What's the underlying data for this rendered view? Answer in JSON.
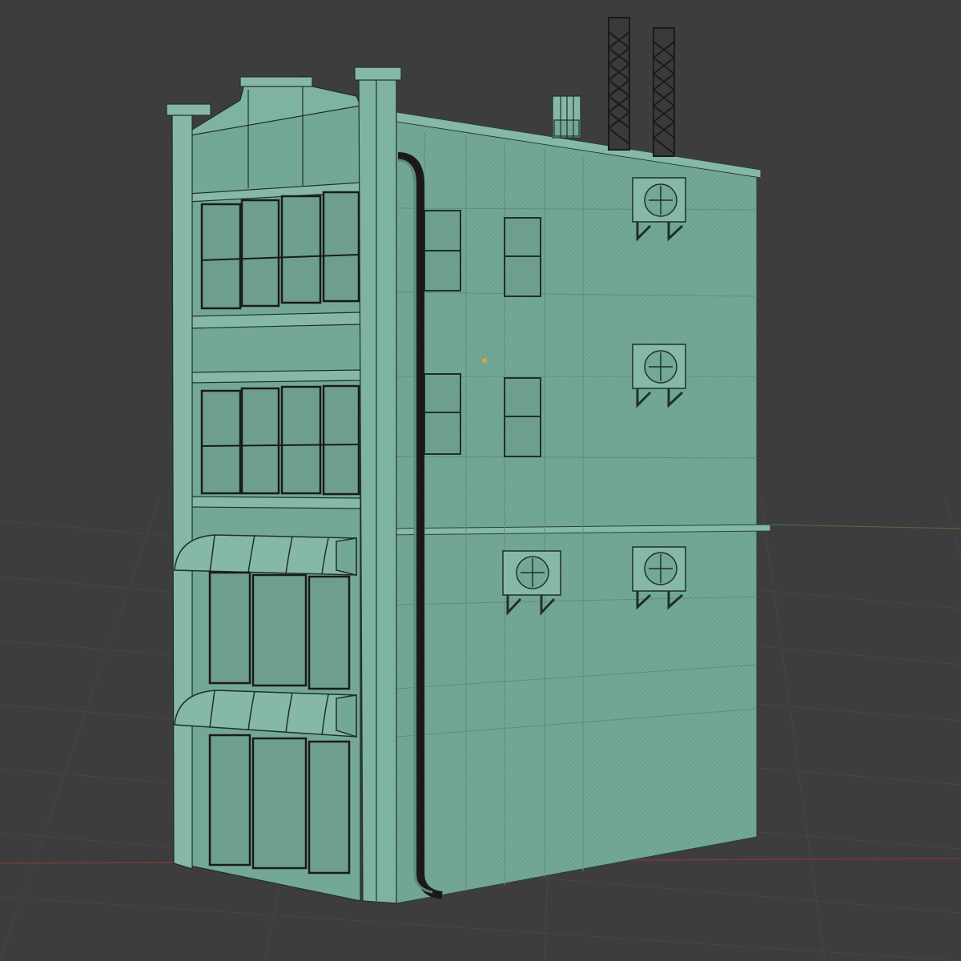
{
  "viewport": {
    "background": "#3d3d3d",
    "grid_color": "#4a4a4a",
    "axis_x_color": "#8a3b3b",
    "axis_y_color": "#4f6b3a"
  },
  "model": {
    "name": "building-wireframe",
    "shading_color": "#74a896",
    "shade_dark": "#5f8d7d",
    "shade_light": "#86b8a6",
    "wire_color": "#1f2f2a",
    "origin_point_color": "#e8a030",
    "ac_unit_count": 4,
    "front_window_count": 8,
    "awning_count": 2
  }
}
